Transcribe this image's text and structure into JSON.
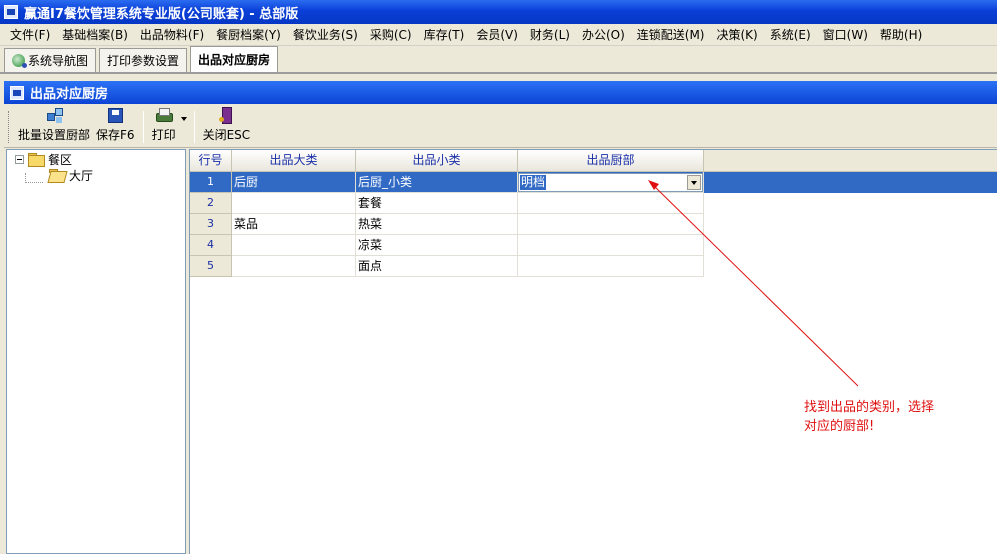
{
  "window": {
    "title": "赢通I7餐饮管理系统专业版(公司账套) - 总部版"
  },
  "menu": [
    "文件(F)",
    "基础档案(B)",
    "出品物料(F)",
    "餐厨档案(Y)",
    "餐饮业务(S)",
    "采购(C)",
    "库存(T)",
    "会员(V)",
    "财务(L)",
    "办公(O)",
    "连锁配送(M)",
    "决策(K)",
    "系统(E)",
    "窗口(W)",
    "帮助(H)"
  ],
  "tabs": [
    {
      "label": "系统导航图"
    },
    {
      "label": "打印参数设置"
    },
    {
      "label": "出品对应厨房"
    }
  ],
  "panel": {
    "title": "出品对应厨房"
  },
  "toolbar": {
    "batch_label": "批量设置厨部",
    "save_label": "保存F6",
    "print_label": "打印",
    "close_label": "关闭ESC"
  },
  "tree": {
    "root": "餐区",
    "child": "大厅"
  },
  "grid": {
    "headers": [
      "行号",
      "出品大类",
      "出品小类",
      "出品厨部"
    ],
    "rows": [
      {
        "num": "1",
        "major": "后厨",
        "minor": "后厨_小类",
        "kitchen": "明档"
      },
      {
        "num": "2",
        "major": "",
        "minor": "套餐",
        "kitchen": ""
      },
      {
        "num": "3",
        "major": "菜品",
        "minor": "热菜",
        "kitchen": ""
      },
      {
        "num": "4",
        "major": "",
        "minor": "凉菜",
        "kitchen": ""
      },
      {
        "num": "5",
        "major": "",
        "minor": "面点",
        "kitchen": ""
      }
    ]
  },
  "annotation": {
    "text": "找到出品的类别，选择对应的厨部!",
    "color": "#e01010"
  },
  "colors": {
    "titlebar": "#0a3fd8",
    "selection": "#316ac5",
    "header_text": "#1a2fa8"
  }
}
